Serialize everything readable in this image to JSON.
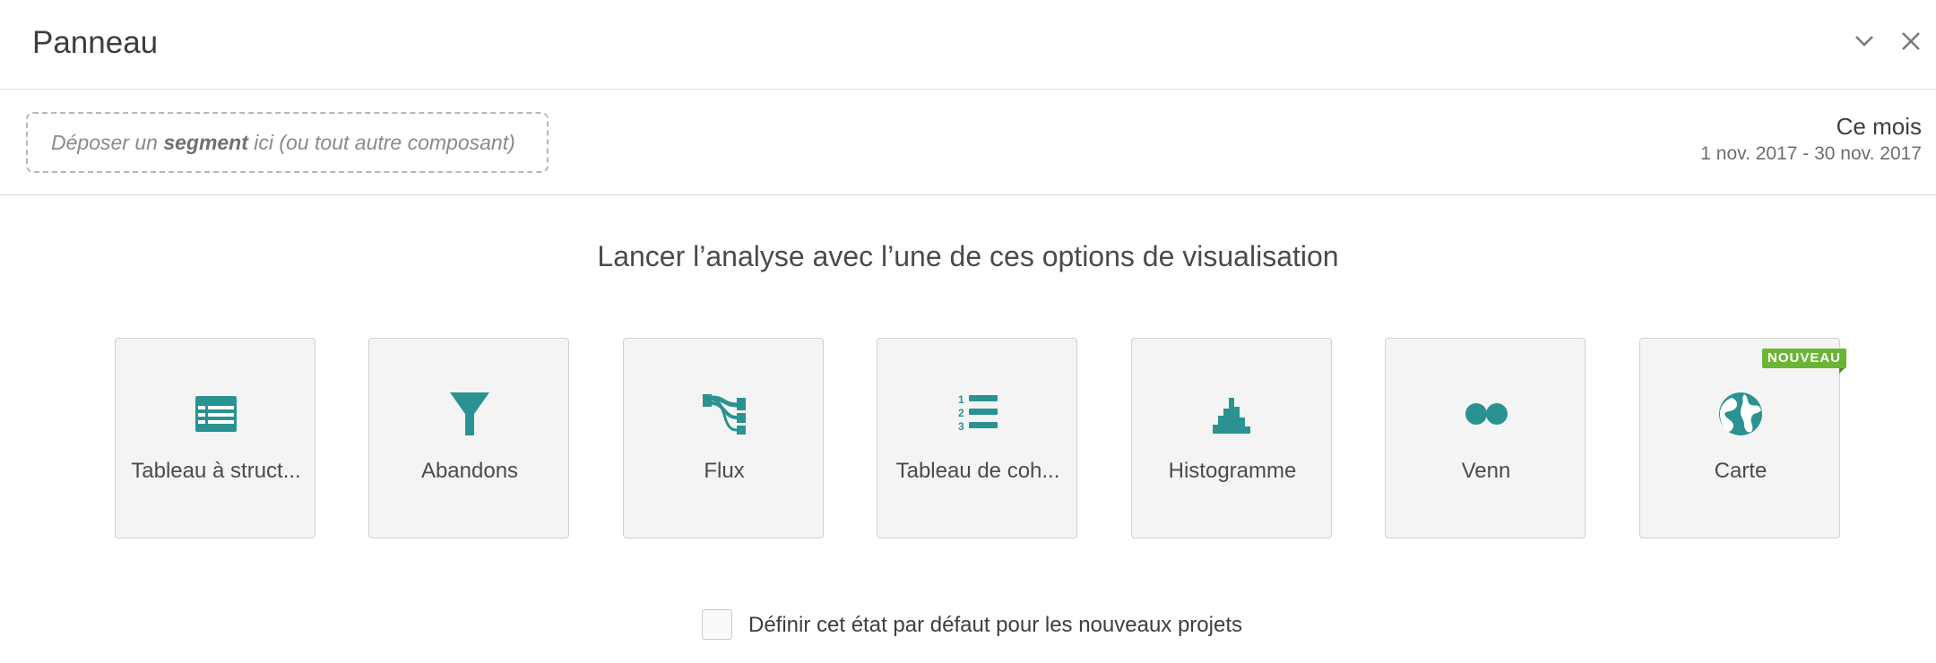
{
  "panel": {
    "title": "Panneau",
    "collapse_icon": "chevron-down-icon",
    "close_icon": "close-icon"
  },
  "segment_drop": {
    "prefix": "Déposer un ",
    "emphasis": "segment",
    "suffix": " ici (ou tout autre composant)"
  },
  "date_range": {
    "label": "Ce mois",
    "range": "1 nov. 2017 - 30 nov. 2017"
  },
  "prompt": "Lancer l’analyse avec l’une de ces options de visualisation",
  "visualizations": [
    {
      "label": "Tableau à struct...",
      "icon": "table-icon"
    },
    {
      "label": "Abandons",
      "icon": "funnel-icon"
    },
    {
      "label": "Flux",
      "icon": "flow-icon"
    },
    {
      "label": "Tableau de coh...",
      "icon": "numbered-list-icon"
    },
    {
      "label": "Histogramme",
      "icon": "histogram-icon"
    },
    {
      "label": "Venn",
      "icon": "venn-icon"
    },
    {
      "label": "Carte",
      "icon": "globe-icon",
      "badge": "NOUVEAU"
    }
  ],
  "default_setting": {
    "label": "Définir cet état par défaut pour les nouveaux projets",
    "checked": false
  },
  "colors": {
    "accent_teal": "#2b9292",
    "badge_green": "#6bb535"
  }
}
